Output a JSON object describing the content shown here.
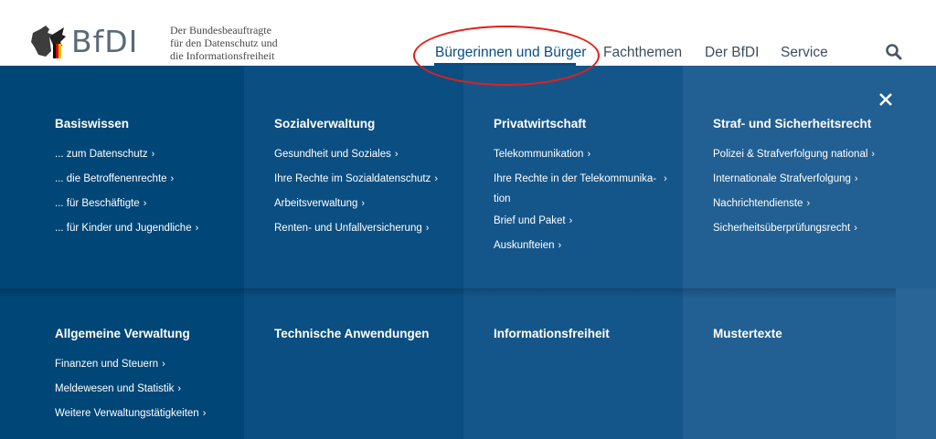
{
  "header": {
    "logo_wordmark": "BfDI",
    "tagline": [
      "Der Bundesbeauftragte",
      "für den Datenschutz und",
      "die Informationsfreiheit"
    ],
    "nav": [
      {
        "label": "Bürgerinnen und Bürger",
        "active": true
      },
      {
        "label": "Fachthemen",
        "active": false
      },
      {
        "label": "Der BfDI",
        "active": false
      },
      {
        "label": "Service",
        "active": false
      }
    ],
    "search_icon": "search-icon",
    "accent_color": "#0b4c84",
    "annotation_color": "#e0201b"
  },
  "menu": {
    "close_icon": "close-icon",
    "colors": [
      "#004677",
      "#0b4e81",
      "#15568a",
      "#225f92"
    ],
    "sections": [
      {
        "title": "Basiswissen",
        "links": [
          "... zum Datenschutz",
          "... die Betroffenenrechte",
          "... für Beschäftigte",
          "... für Kinder und Jugendliche"
        ]
      },
      {
        "title": "Sozialverwaltung",
        "links": [
          "Gesundheit und Soziales",
          "Ihre Rechte im Sozialdatenschutz",
          "Arbeitsverwaltung",
          "Renten- und Unfallversicherung"
        ]
      },
      {
        "title": "Privatwirtschaft",
        "links": [
          "Telekommunikation",
          "Ihre Rechte in der Telekommunika-",
          "tion",
          "Brief und Paket",
          "Auskunfteien"
        ]
      },
      {
        "title": "Straf- und Sicherheitsrecht",
        "links": [
          "Polizei & Strafverfolgung national",
          "Internationale Strafverfolgung",
          "Nachrichtendienste",
          "Sicherheitsüberprüfungsrecht"
        ]
      },
      {
        "title": "Allgemeine Verwaltung",
        "links": [
          "Finanzen und Steuern",
          "Meldewesen und Statistik",
          "Weitere Verwaltungstätigkeiten"
        ]
      },
      {
        "title": "Technische Anwendungen",
        "links": []
      },
      {
        "title": "Informationsfreiheit",
        "links": []
      },
      {
        "title": "Mustertexte",
        "links": []
      }
    ]
  }
}
